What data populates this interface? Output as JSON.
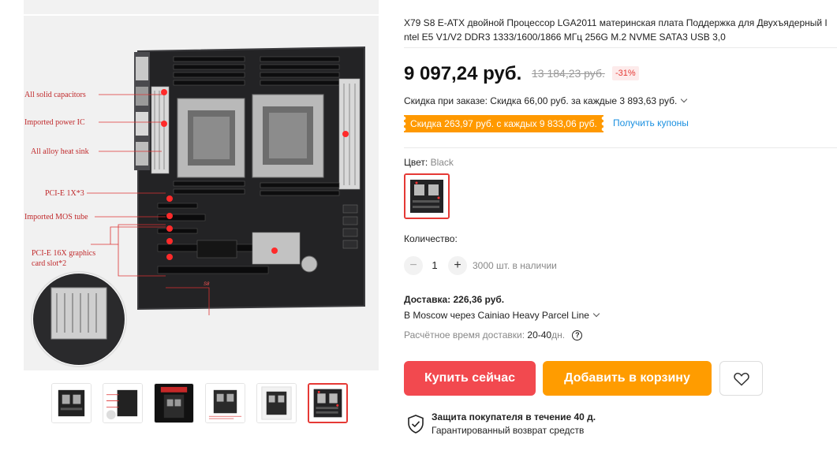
{
  "product": {
    "title_line1": "X79 S8 E-ATX двойной Процессор LGA2011 материнская плата Поддержка для Двухъядерный I",
    "title_line2": "ntel E5 V1/V2 DDR3 1333/1600/1866 МГц 256G M.2 NVME SATA3 USB 3,0",
    "price": "9 097,24 руб.",
    "old_price": "13 184,23 руб.",
    "discount": "-31%"
  },
  "gallery": {
    "callouts": [
      "All solid capacitors",
      "Imported power IC",
      "All alloy heat sink",
      "PCI-E 1X*3",
      "Imported MOS tube",
      "PCI-E 16X graphics",
      "card slot*2"
    ],
    "board_label": "S8",
    "thumbnail_count": 6,
    "active_thumbnail": 6
  },
  "promo": {
    "order_discount": "Скидка при заказе: Скидка 66,00 руб. за каждые 3 893,63 руб.",
    "coupon": "Скидка 263,97 руб. с каждых 9 833,06 руб.",
    "get_coupons": "Получить купоны"
  },
  "color": {
    "label": "Цвет:",
    "value": "Black"
  },
  "quantity": {
    "label": "Количество:",
    "minus": "−",
    "value": "1",
    "plus": "+",
    "stock": "3000 шт. в наличии"
  },
  "delivery": {
    "title": "Доставка: 226,36 руб.",
    "route": "В Moscow через Cainiao Heavy Parcel Line",
    "eta_label": "Расчётное время доставки:",
    "eta_value": "20-40",
    "eta_unit": "дн.",
    "help_glyph": "?"
  },
  "actions": {
    "buy_now": "Купить сейчас",
    "add_to_cart": "Добавить в корзину"
  },
  "protection": {
    "title": "Защита покупателя в течение 40 д.",
    "subtitle": "Гарантированный возврат средств"
  },
  "colors": {
    "accent_red": "#f2494f",
    "accent_orange": "#ff9c00",
    "link_blue": "#1a90e0"
  }
}
